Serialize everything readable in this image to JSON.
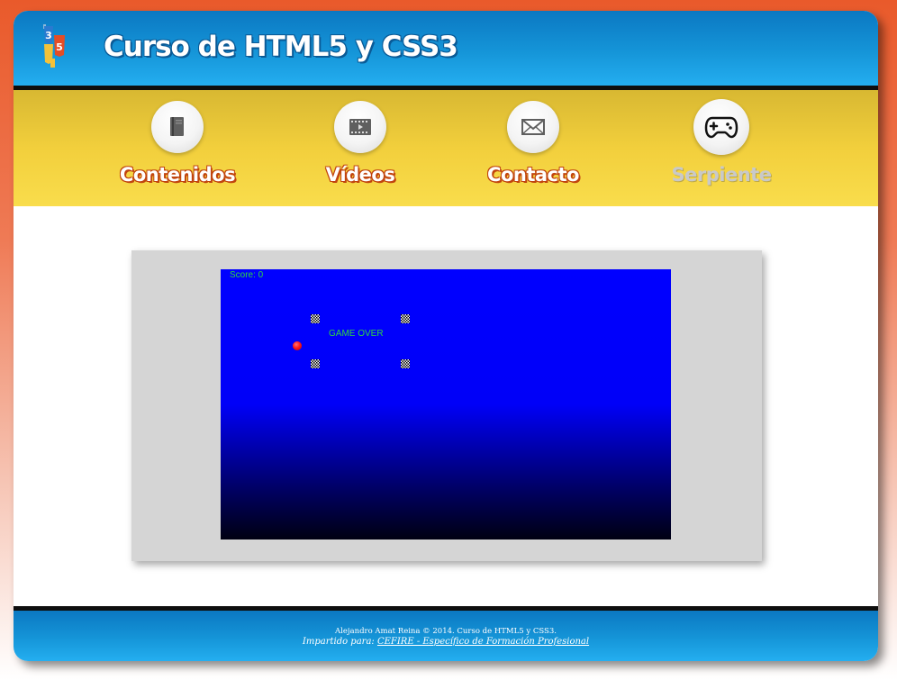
{
  "header": {
    "title": "Curso de HTML5 y CSS3",
    "logo_icon": "html5-css3-logo-icon"
  },
  "nav": {
    "items": [
      {
        "label": "Contenidos",
        "icon": "book-icon",
        "active": false
      },
      {
        "label": "Vídeos",
        "icon": "video-icon",
        "active": false
      },
      {
        "label": "Contacto",
        "icon": "envelope-icon",
        "active": false
      },
      {
        "label": "Serpiente",
        "icon": "gamepad-icon",
        "active": true
      }
    ]
  },
  "game": {
    "score_text": "Score: 0",
    "status_text": "GAME OVER"
  },
  "footer": {
    "line1": "Alejandro Amat Reina © 2014. Curso de HTML5 y CSS3.",
    "line2_prefix": "Impartido para:",
    "line2_link": "CEFIRE - Específico de Formación Profesional"
  },
  "colors": {
    "header_blue": "#1595d8",
    "nav_yellow": "#f2cf3c",
    "canvas_blue": "#0000ff",
    "score_green": "#2fd640",
    "nav_label_shadow": "#c1440e"
  }
}
